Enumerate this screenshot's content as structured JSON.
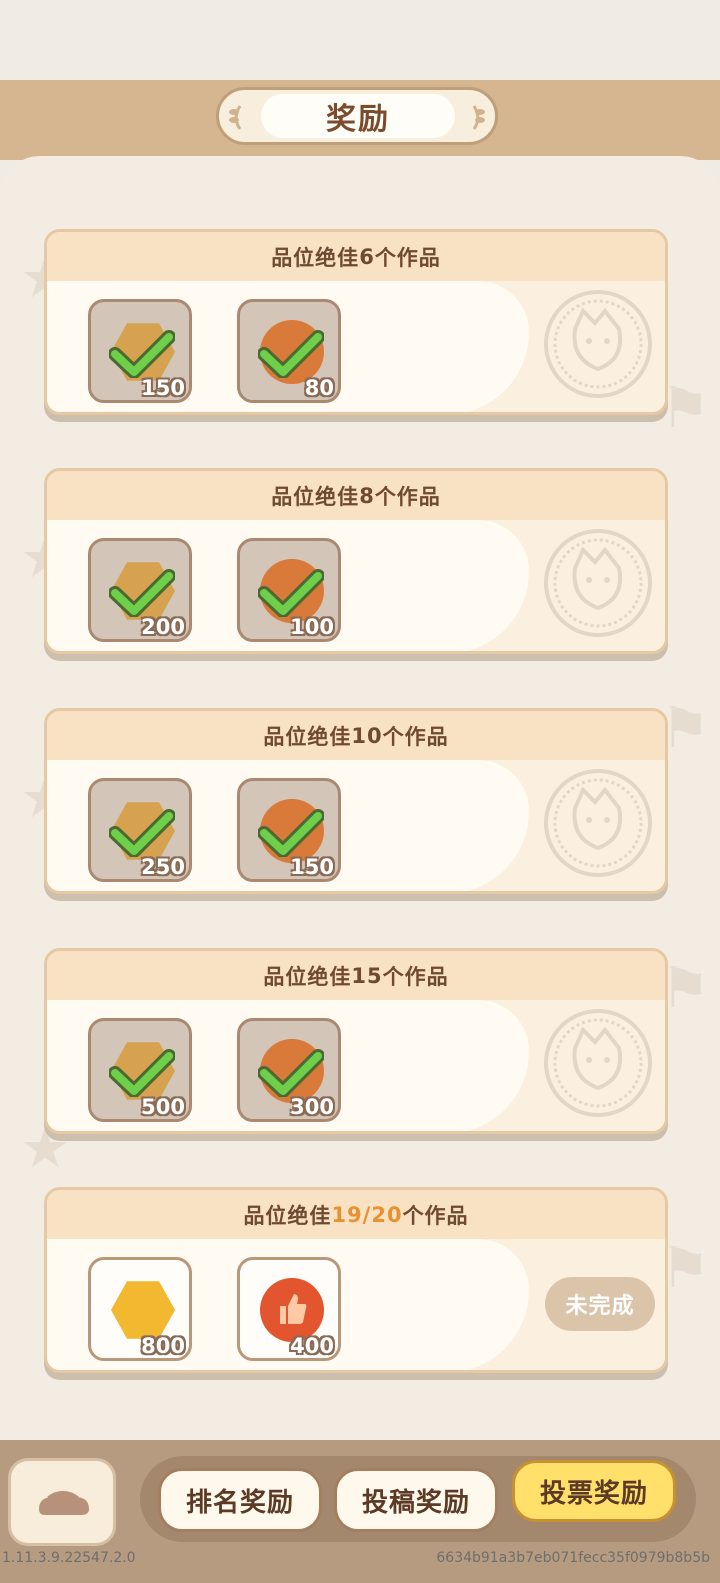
{
  "header": {
    "title": "奖励"
  },
  "cards": [
    {
      "title_prefix": "品位绝佳",
      "title_progress": "6",
      "title_suffix": "个作品",
      "highlight": false,
      "rewards": [
        {
          "icon": "hex-coin-icon",
          "amount": "150",
          "claimed": true
        },
        {
          "icon": "thumb-coin-icon",
          "amount": "80",
          "claimed": true
        }
      ],
      "status": "claimed"
    },
    {
      "title_prefix": "品位绝佳",
      "title_progress": "8",
      "title_suffix": "个作品",
      "highlight": false,
      "rewards": [
        {
          "icon": "hex-coin-icon",
          "amount": "200",
          "claimed": true
        },
        {
          "icon": "thumb-coin-icon",
          "amount": "100",
          "claimed": true
        }
      ],
      "status": "claimed"
    },
    {
      "title_prefix": "品位绝佳",
      "title_progress": "10",
      "title_suffix": "个作品",
      "highlight": false,
      "rewards": [
        {
          "icon": "hex-coin-icon",
          "amount": "250",
          "claimed": true
        },
        {
          "icon": "thumb-coin-icon",
          "amount": "150",
          "claimed": true
        }
      ],
      "status": "claimed"
    },
    {
      "title_prefix": "品位绝佳",
      "title_progress": "15",
      "title_suffix": "个作品",
      "highlight": false,
      "rewards": [
        {
          "icon": "hex-coin-icon",
          "amount": "500",
          "claimed": true
        },
        {
          "icon": "thumb-coin-icon",
          "amount": "300",
          "claimed": true
        }
      ],
      "status": "claimed"
    },
    {
      "title_prefix": "品位绝佳",
      "title_progress": "19/20",
      "title_suffix": "个作品",
      "highlight": true,
      "rewards": [
        {
          "icon": "hex-coin-icon",
          "amount": "800",
          "claimed": false
        },
        {
          "icon": "thumb-coin-icon",
          "amount": "400",
          "claimed": false
        }
      ],
      "status": "incomplete",
      "status_label": "未完成"
    }
  ],
  "tabs": [
    {
      "label": "排名奖励",
      "active": false
    },
    {
      "label": "投稿奖励",
      "active": false
    },
    {
      "label": "投票奖励",
      "active": true
    }
  ],
  "footer": {
    "version": "1.11.3.9.22547.2.0",
    "build_hash": "6634b91a3b7eb071fecc35f0979b8b5b"
  },
  "colors": {
    "accent_progress": "#e8912e",
    "active_tab": "#ffe06a",
    "check_green": "#6fcf4a"
  }
}
